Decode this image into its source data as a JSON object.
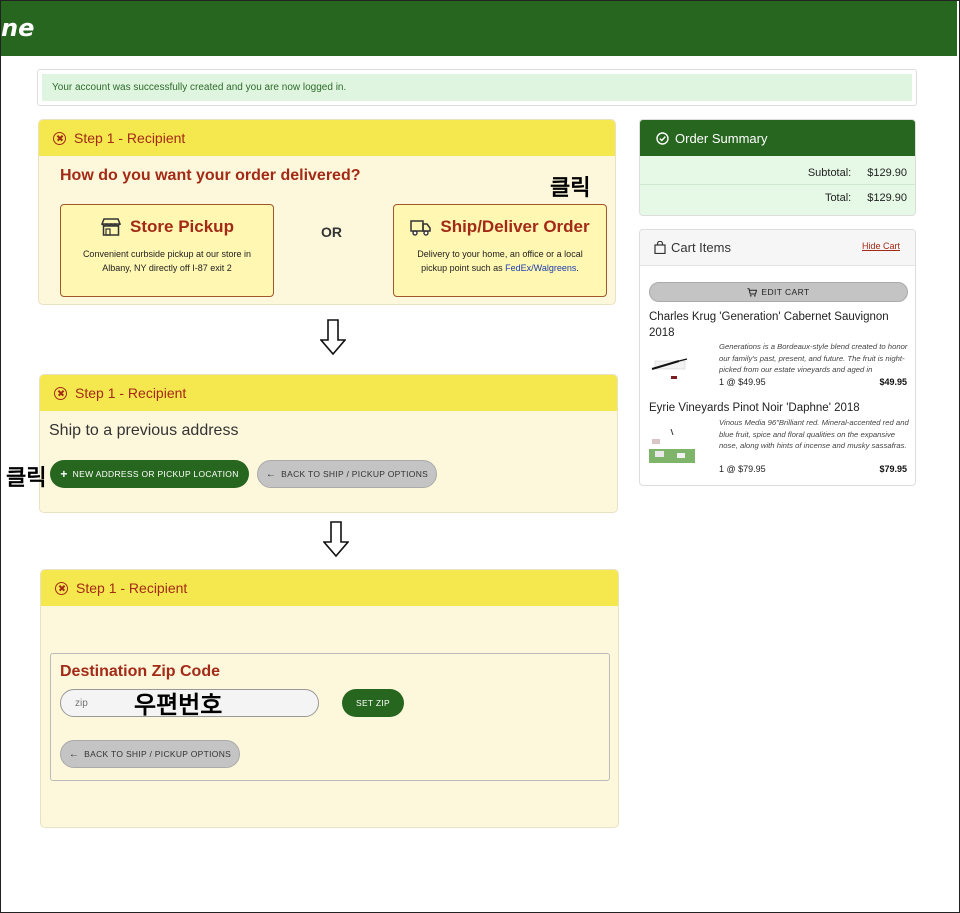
{
  "header": {
    "logo_text": "ne"
  },
  "alert": {
    "message": "Your account was successfully created and you are now logged in."
  },
  "step1": {
    "header": "Step 1 - Recipient",
    "question": "How do you want your order delivered?",
    "pickup": {
      "title": "Store Pickup",
      "desc_line1": "Convenient curbside pickup at our store in",
      "desc_line2": "Albany, NY directly off I-87 exit 2"
    },
    "or_label": "OR",
    "ship": {
      "title": "Ship/Deliver Order",
      "desc_line1": "Delivery to your home, an office or a local",
      "desc_line2_prefix": "pickup point such as ",
      "desc_link": "FedEx/Walgreens",
      "desc_line2_suffix": "."
    }
  },
  "annotations": {
    "click1": "클릭",
    "click2": "클릭",
    "zip_hint": "우편번호"
  },
  "step1b": {
    "header": "Step 1 - Recipient",
    "ship_prev": "Ship to a previous address",
    "new_address_button": "NEW ADDRESS OR PICKUP LOCATION",
    "back_button": "BACK TO SHIP / PICKUP OPTIONS"
  },
  "step1c": {
    "header": "Step 1 - Recipient",
    "zip_title": "Destination Zip Code",
    "zip_placeholder": "zip",
    "set_zip_button": "SET ZIP",
    "back_button": "BACK TO SHIP / PICKUP OPTIONS"
  },
  "summary": {
    "title": "Order Summary",
    "subtotal_label": "Subtotal:",
    "subtotal_value": "$129.90",
    "total_label": "Total:",
    "total_value": "$129.90"
  },
  "cart": {
    "title": "Cart Items",
    "hide_link": "Hide Cart",
    "edit_button": "EDIT CART",
    "items": [
      {
        "name": "Charles Krug 'Generation' Cabernet Sauvignon 2018",
        "desc": "Generations is a Bordeaux-style blend created to honor our family's past, present, and future. The fruit is night-picked from our estate vineyards and aged in",
        "qty": "1 @ $49.95",
        "price": "$49.95"
      },
      {
        "name": "Eyrie Vineyards Pinot Noir 'Daphne' 2018",
        "desc": "Vinous Media 96\"Brilliant red. Mineral-accented red and blue fruit, spice and floral qualities on the expansive nose, along with hints of incense and musky sassafras.",
        "qty": "1 @ $79.95",
        "price": "$79.95"
      }
    ]
  }
}
